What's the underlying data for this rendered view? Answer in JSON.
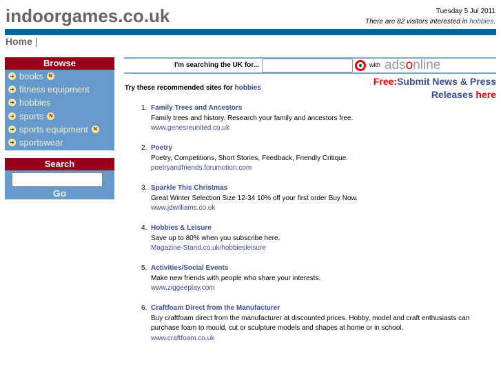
{
  "header": {
    "logo": "indoorgames.co.uk",
    "date": "Tuesday 5 Jul 2011",
    "visitors_text": "There are 82 visitors interested in ",
    "visitors_link": "hobbies",
    "visitors_end": "."
  },
  "nav": {
    "home": "Home",
    "sep": "|"
  },
  "browse": {
    "title": "Browse",
    "new_badge": "N",
    "items": [
      {
        "label": "books",
        "new": true
      },
      {
        "label": "fitness equipment",
        "new": false
      },
      {
        "label": "hobbies",
        "new": false
      },
      {
        "label": "sports",
        "new": true
      },
      {
        "label": "sports equipment",
        "new": true
      },
      {
        "label": "sportswear",
        "new": false
      }
    ]
  },
  "search": {
    "title": "Search",
    "value": "",
    "go": "Go"
  },
  "adsearch": {
    "label": "I'm searching the UK for...",
    "value": "",
    "with": "with",
    "brand_a": "ads",
    "brand_o": "o",
    "brand_b": "nline"
  },
  "main": {
    "try_text": "Try these recommended sites for ",
    "try_link": "hobbies",
    "free": "Free:",
    "submit": "Submit News & Press Releases ",
    "here": "here",
    "results": [
      {
        "num": "1.",
        "title": "Family Trees and Ancestors",
        "desc": "Family trees and history. Research your family and ancestors free.",
        "url": "www.genesreunited.co.uk"
      },
      {
        "num": "2.",
        "title": "Poetry",
        "desc": "Poetry, Competitions, Short Stories, Feedback, Friendly Critique.",
        "url": "poetryandfriends.forumotion.com"
      },
      {
        "num": "3.",
        "title": "Sparkle This Christmas",
        "desc": "Great Winter Selection Size 12-34 10% off your first order Buy Now.",
        "url": "www.jdwilliams.co.uk"
      },
      {
        "num": "4.",
        "title": "Hobbies & Leisure",
        "desc": "Save up to 80% when you subscribe here.",
        "url": "Magazine-Stand.co.uk/hobbiesleisure"
      },
      {
        "num": "5.",
        "title": "Activities/Social Events",
        "desc": "Make new friends with people who share your interests.",
        "url": "www.ziggeeplay.com"
      },
      {
        "num": "6.",
        "title": "Craftfoam Direct from the Manufacturer",
        "desc": "Buy craftfoam direct from the manufacturer at discounted prices. Hobby, model and craft enthusiasts can purchase foam to mould, cut or sculpture models and shapes at home or in school.",
        "url": "www.craftfoam.co.uk"
      }
    ]
  }
}
